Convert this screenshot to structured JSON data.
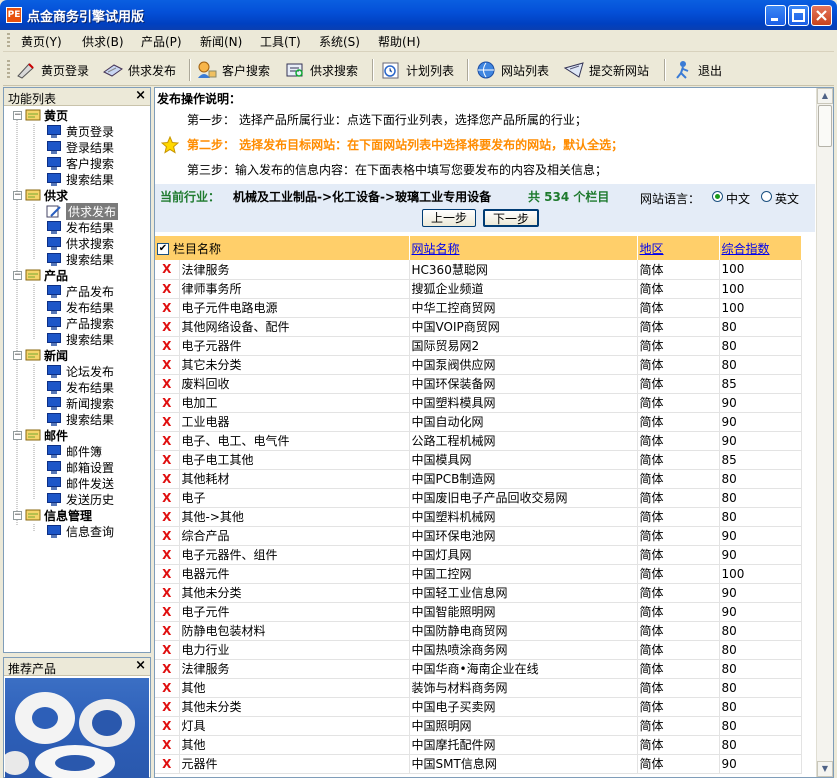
{
  "window": {
    "title": "点金商务引擎试用版",
    "app_icon": "PE"
  },
  "menu": [
    "黄页(Y)",
    "供求(B)",
    "产品(P)",
    "新闻(N)",
    "工具(T)",
    "系统(S)",
    "帮助(H)"
  ],
  "toolbar": [
    {
      "label": "黄页登录",
      "icon": "yellowpage-login-icon"
    },
    {
      "label": "供求发布",
      "icon": "supply-publish-icon"
    },
    {
      "label": "客户搜索",
      "icon": "customer-search-icon"
    },
    {
      "label": "供求搜索",
      "icon": "supply-search-icon"
    },
    {
      "label": "计划列表",
      "icon": "plan-list-icon"
    },
    {
      "label": "网站列表",
      "icon": "site-list-icon"
    },
    {
      "label": "提交新网站",
      "icon": "submit-site-icon"
    },
    {
      "label": "退出",
      "icon": "exit-icon"
    }
  ],
  "left_panel": {
    "title": "功能列表",
    "close": "×",
    "groups": [
      {
        "label": "黄页",
        "items": [
          "黄页登录",
          "登录结果",
          "客户搜索",
          "搜索结果"
        ]
      },
      {
        "label": "供求",
        "items": [
          "供求发布",
          "发布结果",
          "供求搜索",
          "搜索结果"
        ]
      },
      {
        "label": "产品",
        "items": [
          "产品发布",
          "发布结果",
          "产品搜索",
          "搜索结果"
        ]
      },
      {
        "label": "新闻",
        "items": [
          "论坛发布",
          "发布结果",
          "新闻搜索",
          "搜索结果"
        ]
      },
      {
        "label": "邮件",
        "items": [
          "邮件簿",
          "邮箱设置",
          "邮件发送",
          "发送历史"
        ]
      },
      {
        "label": "信息管理",
        "items": [
          "信息查询"
        ]
      }
    ],
    "selected": "供求发布"
  },
  "rec_panel": {
    "title": "推荐产品",
    "close": "×"
  },
  "instructions": {
    "heading": "发布操作说明：",
    "step1": "第一步：  选择产品所属行业：点选下面行业列表，选择您产品所属的行业；",
    "step2": "第二步：  选择发布目标网站：在下面网站列表中选择将要发布的网站，默认全选；",
    "step3": "第三步：输入发布的信息内容：在下面表格中填写您要发布的内容及相关信息；"
  },
  "industry": {
    "label": "当前行业：",
    "path": "机械及工业制品->化工设备->玻璃工业专用设备",
    "count": "共 534 个栏目",
    "lang_label": "网站语言：",
    "lang_cn": "中文",
    "lang_en": "英文",
    "prev": "上一步",
    "next": "下一步"
  },
  "table": {
    "headers": [
      "栏目名称",
      "网站名称",
      "地区",
      "综合指数"
    ],
    "row_mark": "X",
    "rows": [
      [
        "法律服务",
        "HC360慧聪网",
        "简体",
        "100"
      ],
      [
        "律师事务所",
        "搜狐企业频道",
        "简体",
        "100"
      ],
      [
        "电子元件电路电源",
        "中华工控商贸网",
        "简体",
        "100"
      ],
      [
        "其他网络设备、配件",
        "中国VOIP商贸网",
        "简体",
        "80"
      ],
      [
        "电子元器件",
        "国际贸易网2",
        "简体",
        "80"
      ],
      [
        "其它未分类",
        "中国泵阀供应网",
        "简体",
        "80"
      ],
      [
        "废料回收",
        "中国环保装备网",
        "简体",
        "85"
      ],
      [
        "电加工",
        "中国塑料模具网",
        "简体",
        "90"
      ],
      [
        "工业电器",
        "中国自动化网",
        "简体",
        "90"
      ],
      [
        "电子、电工、电气件",
        "公路工程机械网",
        "简体",
        "90"
      ],
      [
        "电子电工其他",
        "中国模具网",
        "简体",
        "85"
      ],
      [
        "其他耗材",
        "中国PCB制造网",
        "简体",
        "80"
      ],
      [
        "电子",
        "中国废旧电子产品回收交易网",
        "简体",
        "80"
      ],
      [
        "其他->其他",
        "中国塑料机械网",
        "简体",
        "80"
      ],
      [
        "综合产品",
        "中国环保电池网",
        "简体",
        "90"
      ],
      [
        "电子元器件、组件",
        "中国灯具网",
        "简体",
        "90"
      ],
      [
        "电器元件",
        "中国工控网",
        "简体",
        "100"
      ],
      [
        "其他未分类",
        "中国轻工业信息网",
        "简体",
        "90"
      ],
      [
        "电子元件",
        "中国智能照明网",
        "简体",
        "90"
      ],
      [
        "防静电包装材料",
        "中国防静电商贸网",
        "简体",
        "80"
      ],
      [
        "电力行业",
        "中国热喷涂商务网",
        "简体",
        "80"
      ],
      [
        "法律服务",
        "中国华商•海南企业在线",
        "简体",
        "80"
      ],
      [
        "其他",
        "装饰与材料商务网",
        "简体",
        "80"
      ],
      [
        "其他未分类",
        "中国电子买卖网",
        "简体",
        "80"
      ],
      [
        "灯具",
        "中国照明网",
        "简体",
        "80"
      ],
      [
        "其他",
        "中国摩托配件网",
        "简体",
        "80"
      ],
      [
        "元器件",
        "中国SMT信息网",
        "简体",
        "90"
      ]
    ]
  },
  "colors": {
    "titlebar": "#0450d8",
    "header_row": "#ffcf6a",
    "accent_step": "#ff8c00",
    "industry_label": "#1e7a2e",
    "delete_mark": "#e01010"
  }
}
